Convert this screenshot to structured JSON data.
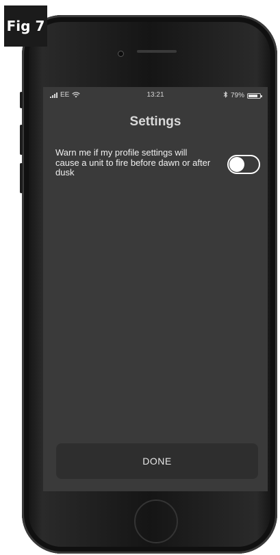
{
  "figure": {
    "label": "Fig 7"
  },
  "status_bar": {
    "carrier": "EE",
    "time": "13:21",
    "bluetooth": "bluetooth-icon",
    "battery_percent": "79%",
    "battery_level": 0.79
  },
  "screen": {
    "title": "Settings",
    "setting": {
      "text": "Warn me if my profile settings will cause a unit to fire before dawn or after dusk",
      "toggle_on": false
    },
    "done_label": "DONE"
  },
  "colors": {
    "screen_bg": "#3a3a3a",
    "button_bg": "#2e2e2e",
    "text": "#f0f0f0",
    "toggle_border": "#ffffff"
  }
}
